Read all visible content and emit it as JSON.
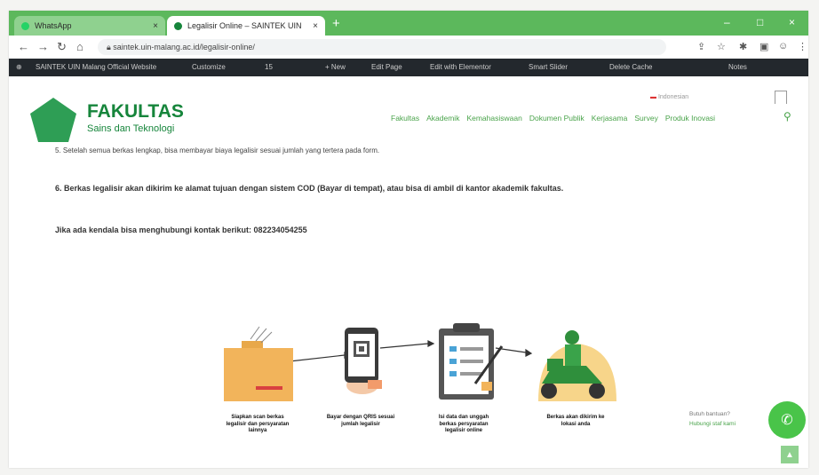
{
  "browser": {
    "tabs": [
      {
        "label": "WhatsApp",
        "color": "#25d366"
      },
      {
        "label": "Legalisir Online – SAINTEK UIN",
        "color": "#16853b"
      }
    ],
    "new_tab": "+",
    "url": "saintek.uin-malang.ac.id/legalisir-online/",
    "window_controls": [
      "–",
      "□",
      "×"
    ]
  },
  "adminbar": {
    "items": [
      "SAINTEK UIN Malang Official Website",
      "Customize",
      "15",
      "+ New",
      "Edit Page",
      "Edit with Elementor",
      "Smart Slider",
      "Delete Cache"
    ],
    "right": "Notes"
  },
  "header": {
    "brand_title": "FAKULTAS",
    "brand_sub": "Sains dan Teknologi",
    "menu": [
      "Fakultas",
      "Akademik",
      "Kemahasiswaan",
      "Dokumen Publik",
      "Kerjasama",
      "Survey",
      "Produk Inovasi"
    ],
    "lang": "Indonesian",
    "accent": "#16853b"
  },
  "content": {
    "cut_line": "5. Setelah semua berkas lengkap, bisa membayar biaya legalisir sesuai jumlah yang tertera pada form.",
    "item6": "6. Berkas legalisir akan dikirim ke alamat tujuan dengan sistem COD (Bayar di tempat), atau bisa di ambil di kantor akademik fakultas.",
    "contact": "Jika ada kendala bisa menghubungi kontak berikut: 082234054255"
  },
  "steps": [
    {
      "label": "Siapkan scan berkas legalisir dan persyaratan lainnya"
    },
    {
      "label": "Bayar dengan QRIS sesuai jumlah legalisir"
    },
    {
      "label": "Isi data dan unggah berkas persyaratan legalisir online"
    },
    {
      "label": "Berkas akan dikirim ke lokasi anda"
    }
  ],
  "help": {
    "question": "Butuh bantuan?",
    "link": "Hubungi staf kami"
  },
  "icons": [
    "whatsapp-icon",
    "search-icon",
    "arrow-up-icon",
    "folder-icon",
    "phone-qris-icon",
    "clipboard-icon",
    "delivery-scooter-icon"
  ]
}
